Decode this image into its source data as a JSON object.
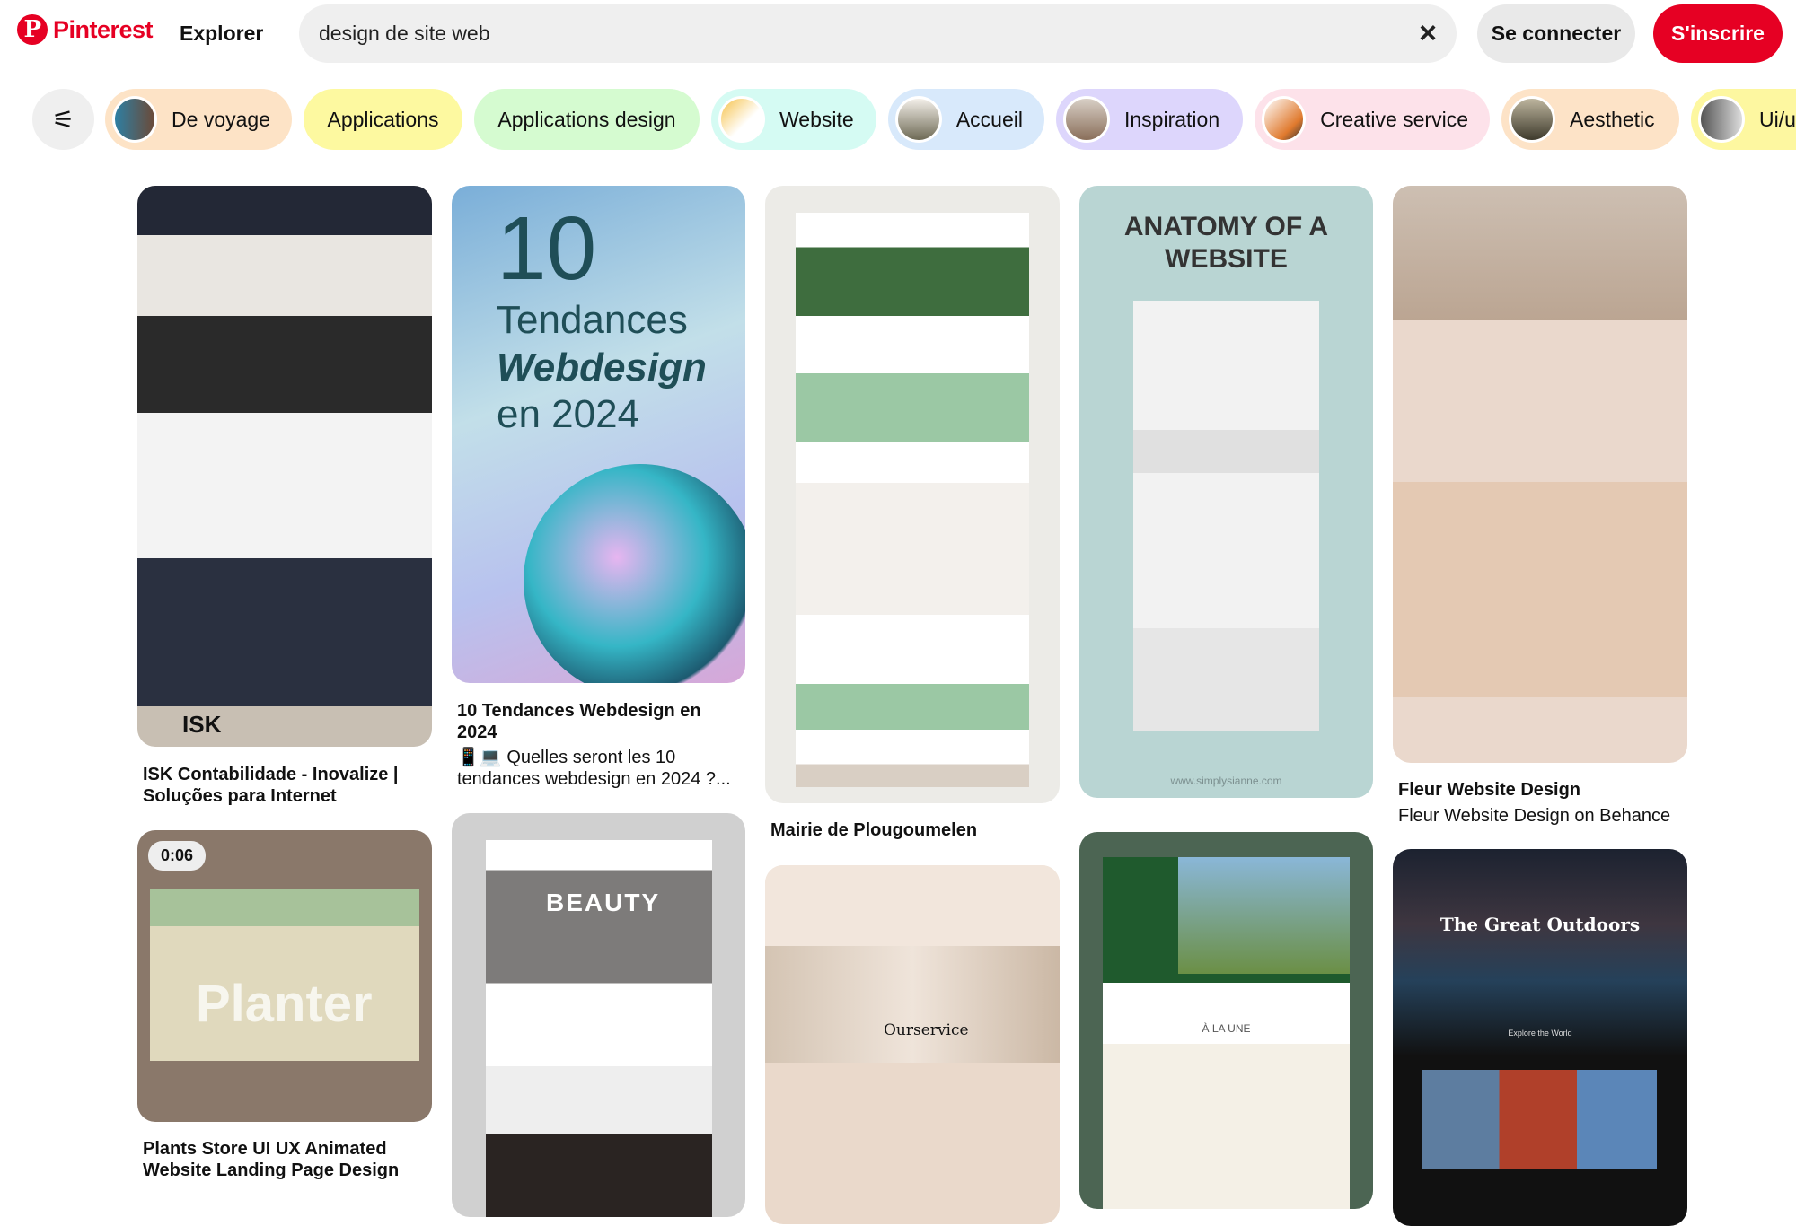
{
  "header": {
    "logo_text": "Pinterest",
    "explore": "Explorer",
    "search_value": "design de site web",
    "clear_icon": "×",
    "login": "Se connecter",
    "signup": "S'inscrire"
  },
  "filters": {
    "icon": "⚟",
    "chips": [
      {
        "label": "De voyage",
        "color": "#fde3c6"
      },
      {
        "label": "Applications",
        "color": "#fdf9a0"
      },
      {
        "label": "Applications design",
        "color": "#d5fbd0"
      },
      {
        "label": "Website",
        "color": "#d5fbf3"
      },
      {
        "label": "Accueil",
        "color": "#d8e9fb"
      },
      {
        "label": "Inspiration",
        "color": "#ddd6fc"
      },
      {
        "label": "Creative service",
        "color": "#fde2ea"
      },
      {
        "label": "Aesthetic",
        "color": "#fde3c7"
      },
      {
        "label": "Ui/ux",
        "color": "#fdf7a0"
      }
    ]
  },
  "pins": [
    {
      "title": "ISK Contabilidade - Inovalize | Soluções para Internet",
      "image_text": "ISK"
    },
    {
      "title": "10 Tendances Webdesign en 2024",
      "subtitle": "📱💻 Quelles seront les 10 tendances webdesign en 2024 ?...",
      "image_num": "10",
      "image_l1": "Tendances",
      "image_l2": "Webdesign",
      "image_l3": "en 2024"
    },
    {
      "title": "Mairie de Plougoumelen"
    },
    {
      "image_text": "ANATOMY OF A WEBSITE",
      "image_footer": "www.simplysianne.com"
    },
    {
      "title": "Fleur Website Design",
      "subtitle": "Fleur Website Design on Behance"
    },
    {
      "title": "Plants Store UI UX Animated Website Landing Page Design",
      "duration": "0:06",
      "image_text": "Planter"
    },
    {
      "image_text": "BEAUTY"
    },
    {
      "image_text": "Ourservice"
    },
    {
      "image_text": "À LA UNE"
    },
    {
      "image_text": "The Great Outdoors",
      "image_sub": "Explore the World"
    }
  ]
}
